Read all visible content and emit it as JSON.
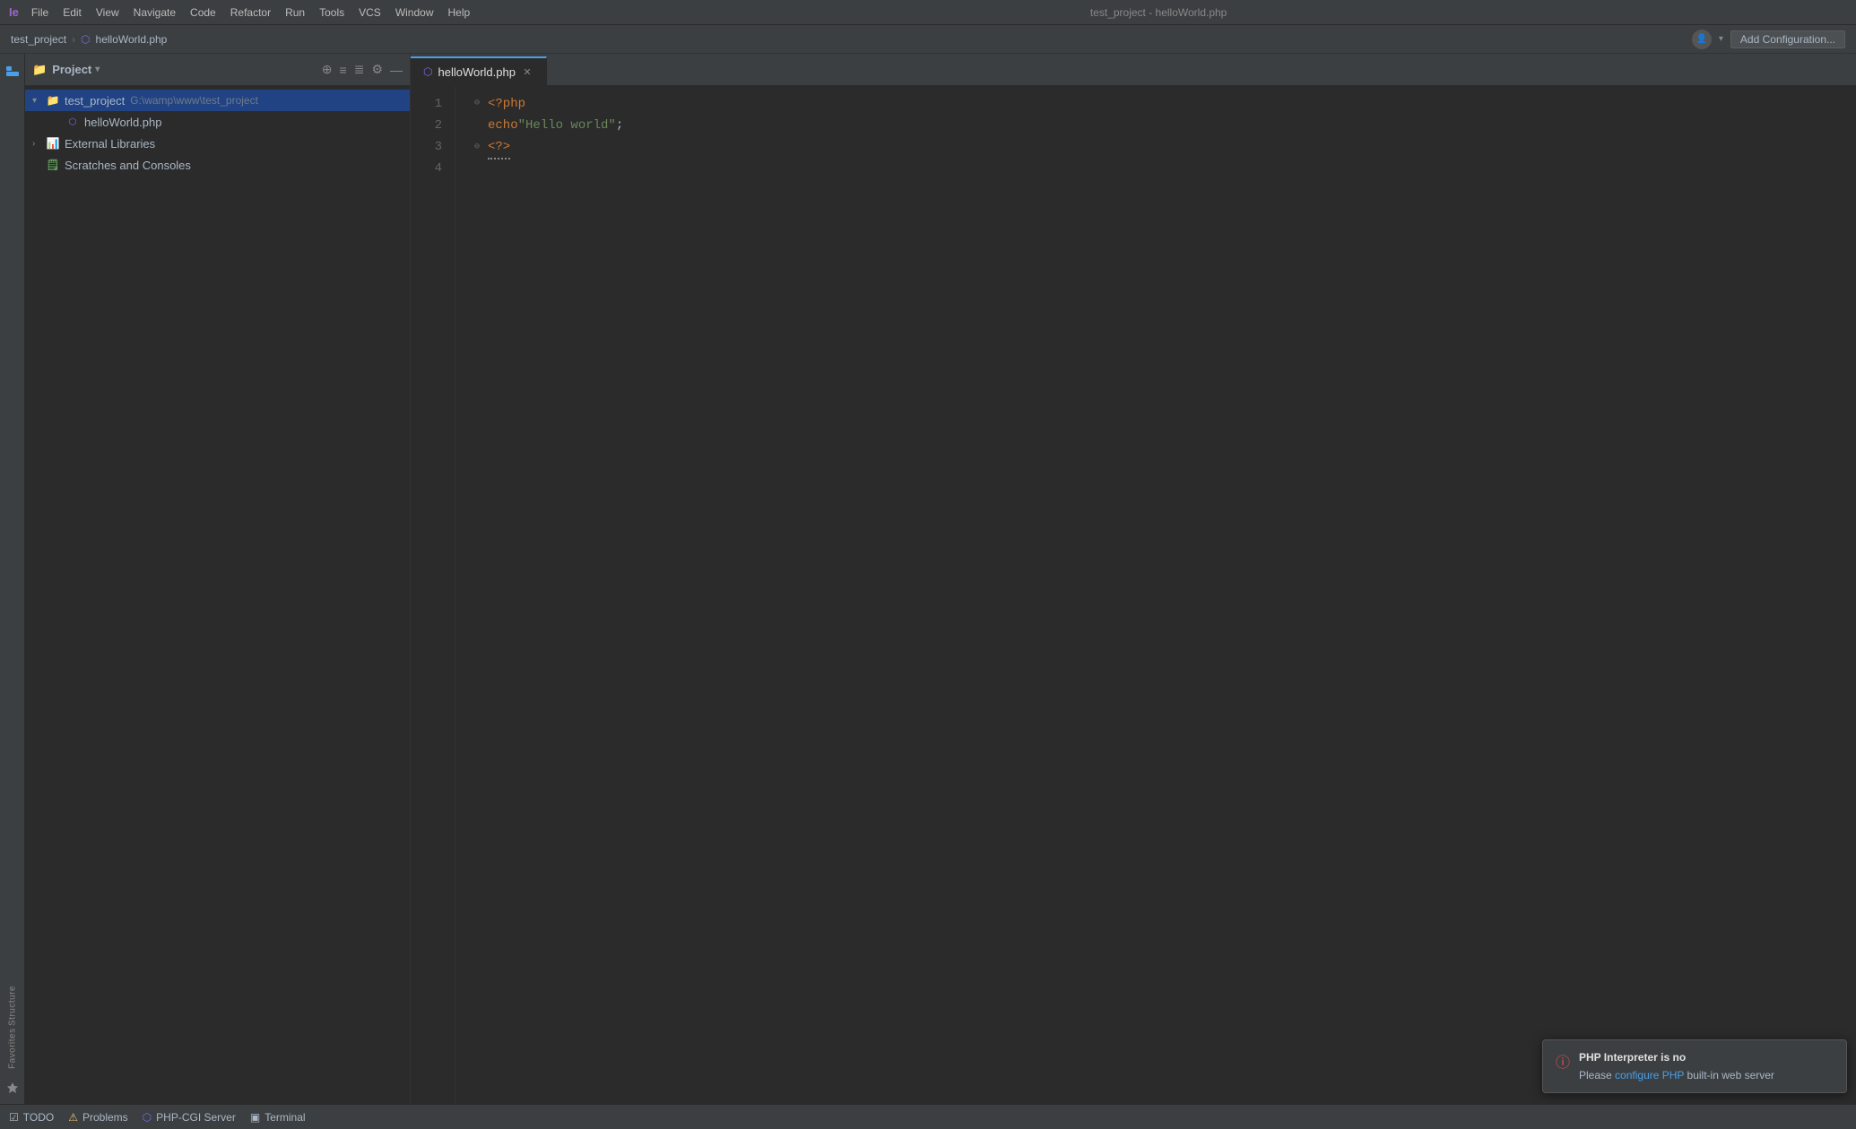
{
  "titlebar": {
    "logo": "Ie",
    "menu": [
      "File",
      "Edit",
      "View",
      "Navigate",
      "Code",
      "Refactor",
      "Run",
      "Tools",
      "VCS",
      "Window",
      "Help"
    ],
    "window_title": "test_project - helloWorld.php"
  },
  "breadcrumb": {
    "project": "test_project",
    "separator": "›",
    "file": "helloWorld.php",
    "add_config_label": "Add Configuration...",
    "profile_icon": "👤"
  },
  "project_panel": {
    "title": "Project",
    "chevron": "▾",
    "icons": [
      "⊕",
      "≡",
      "≣",
      "⚙",
      "—"
    ],
    "tree": [
      {
        "indent": 0,
        "arrow": "▾",
        "icon": "folder",
        "label": "test_project",
        "path": "G:\\wamp\\www\\test_project",
        "selected": true
      },
      {
        "indent": 1,
        "arrow": "",
        "icon": "php",
        "label": "helloWorld.php",
        "path": "",
        "selected": false
      },
      {
        "indent": 0,
        "arrow": "›",
        "icon": "extlib",
        "label": "External Libraries",
        "path": "",
        "selected": false
      },
      {
        "indent": 0,
        "arrow": "",
        "icon": "scratch",
        "label": "Scratches and Consoles",
        "path": "",
        "selected": false
      }
    ]
  },
  "editor": {
    "tab": {
      "icon": "php",
      "label": "helloWorld.php",
      "close": "✕"
    },
    "lines": [
      {
        "number": "1",
        "gutter": "⊖",
        "code": "<?php",
        "type": "tag"
      },
      {
        "number": "2",
        "gutter": "",
        "code_parts": [
          {
            "text": "echo ",
            "type": "keyword"
          },
          {
            "text": "\"Hello world\"",
            "type": "string"
          },
          {
            "text": ";",
            "type": "plain"
          }
        ]
      },
      {
        "number": "3",
        "gutter": "⊖",
        "code": "?>",
        "type": "tag",
        "squiggly": true
      },
      {
        "number": "4",
        "gutter": "",
        "code": "",
        "type": "plain"
      }
    ]
  },
  "status_bar": {
    "items": [
      {
        "icon": "☑",
        "label": "TODO"
      },
      {
        "icon": "⚠",
        "label": "Problems"
      },
      {
        "icon": "⚙",
        "label": "PHP-CGI Server"
      },
      {
        "icon": "▣",
        "label": "Terminal"
      }
    ]
  },
  "right_panel": {
    "labels": [
      "Structure",
      "Favorites"
    ]
  },
  "notification": {
    "icon": "ⓘ",
    "title": "PHP Interpreter is no",
    "body": "Please ",
    "link": "configure PHP",
    "body2": " built-in web server"
  },
  "sidebar_left": {
    "icons": [
      "📁"
    ]
  }
}
